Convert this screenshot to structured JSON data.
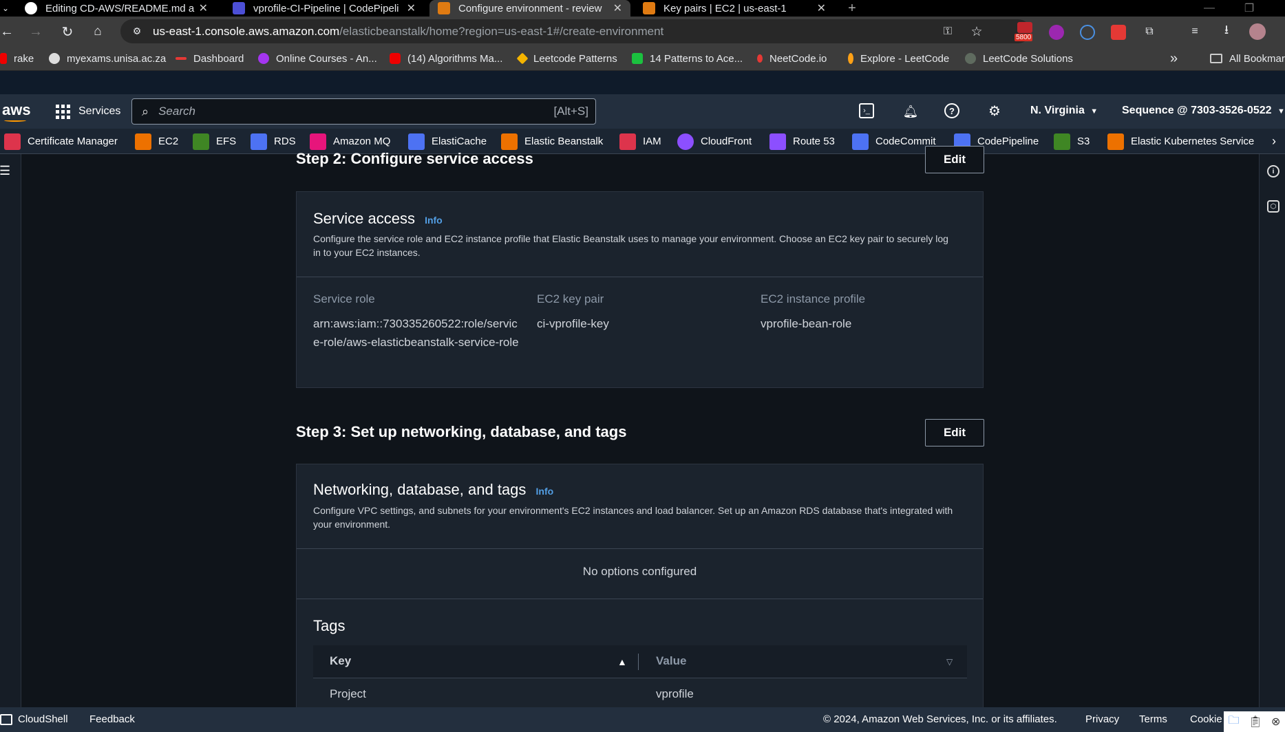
{
  "tabs": [
    {
      "title": "Editing CD-AWS/README.md a",
      "close": "✕"
    },
    {
      "title": "vprofile-CI-Pipeline | CodePipeli",
      "close": "✕"
    },
    {
      "title": "Configure environment - review",
      "close": "✕"
    },
    {
      "title": "Key pairs | EC2 | us-east-1",
      "close": "✕"
    }
  ],
  "new_tab": "+",
  "address": {
    "host": "us-east-1.console.aws.amazon.com",
    "path": "/elasticbeanstalk/home?region=us-east-1#/create-environment"
  },
  "extension_badge": "5800",
  "bookmarks": [
    "rake",
    "myexams.unisa.ac.za",
    "Dashboard",
    "Online Courses - An...",
    "(14) Algorithms Ma...",
    "Leetcode Patterns",
    "14 Patterns to Ace...",
    "NeetCode.io",
    "Explore - LeetCode",
    "LeetCode Solutions"
  ],
  "bookmarks_more": "»",
  "all_bookmarks": "All Bookmar",
  "aws": {
    "logo": "aws",
    "services": "Services",
    "search_placeholder": "Search",
    "search_shortcut": "[Alt+S]",
    "region": "N. Virginia",
    "account": "Sequence @ 7303-3526-0522"
  },
  "service_shortcuts": [
    "Certificate Manager",
    "EC2",
    "EFS",
    "RDS",
    "Amazon MQ",
    "ElastiCache",
    "Elastic Beanstalk",
    "IAM",
    "CloudFront",
    "Route 53",
    "CodeCommit",
    "CodePipeline",
    "S3",
    "Elastic Kubernetes Service"
  ],
  "step2": {
    "title": "Step 2: Configure service access",
    "edit": "Edit",
    "section_title": "Service access",
    "info": "Info",
    "description": "Configure the service role and EC2 instance profile that Elastic Beanstalk uses to manage your environment. Choose an EC2 key pair to securely log in to your EC2 instances.",
    "fields": [
      {
        "label": "Service role",
        "value": "arn:aws:iam::730335260522:role/service-role/aws-elasticbeanstalk-service-role"
      },
      {
        "label": "EC2 key pair",
        "value": "ci-vprofile-key"
      },
      {
        "label": "EC2 instance profile",
        "value": "vprofile-bean-role"
      }
    ]
  },
  "step3": {
    "title": "Step 3: Set up networking, database, and tags",
    "edit": "Edit",
    "section_title": "Networking, database, and tags",
    "info": "Info",
    "description": "Configure VPC settings, and subnets for your environment's EC2 instances and load balancer. Set up an Amazon RDS database that's integrated with your environment.",
    "no_options": "No options configured",
    "tags_title": "Tags",
    "columns": [
      "Key",
      "Value"
    ],
    "rows": [
      {
        "key": "Project",
        "value": "vprofile"
      }
    ]
  },
  "footer": {
    "cloudshell": "CloudShell",
    "feedback": "Feedback",
    "copyright": "© 2024, Amazon Web Services, Inc. or its affiliates.",
    "privacy": "Privacy",
    "terms": "Terms",
    "cookie": "Cookie"
  },
  "colors": {
    "aws_nav": "#232f3e",
    "link": "#539fe5",
    "page_bg": "#0f141a",
    "card_bg": "#1b232d"
  }
}
